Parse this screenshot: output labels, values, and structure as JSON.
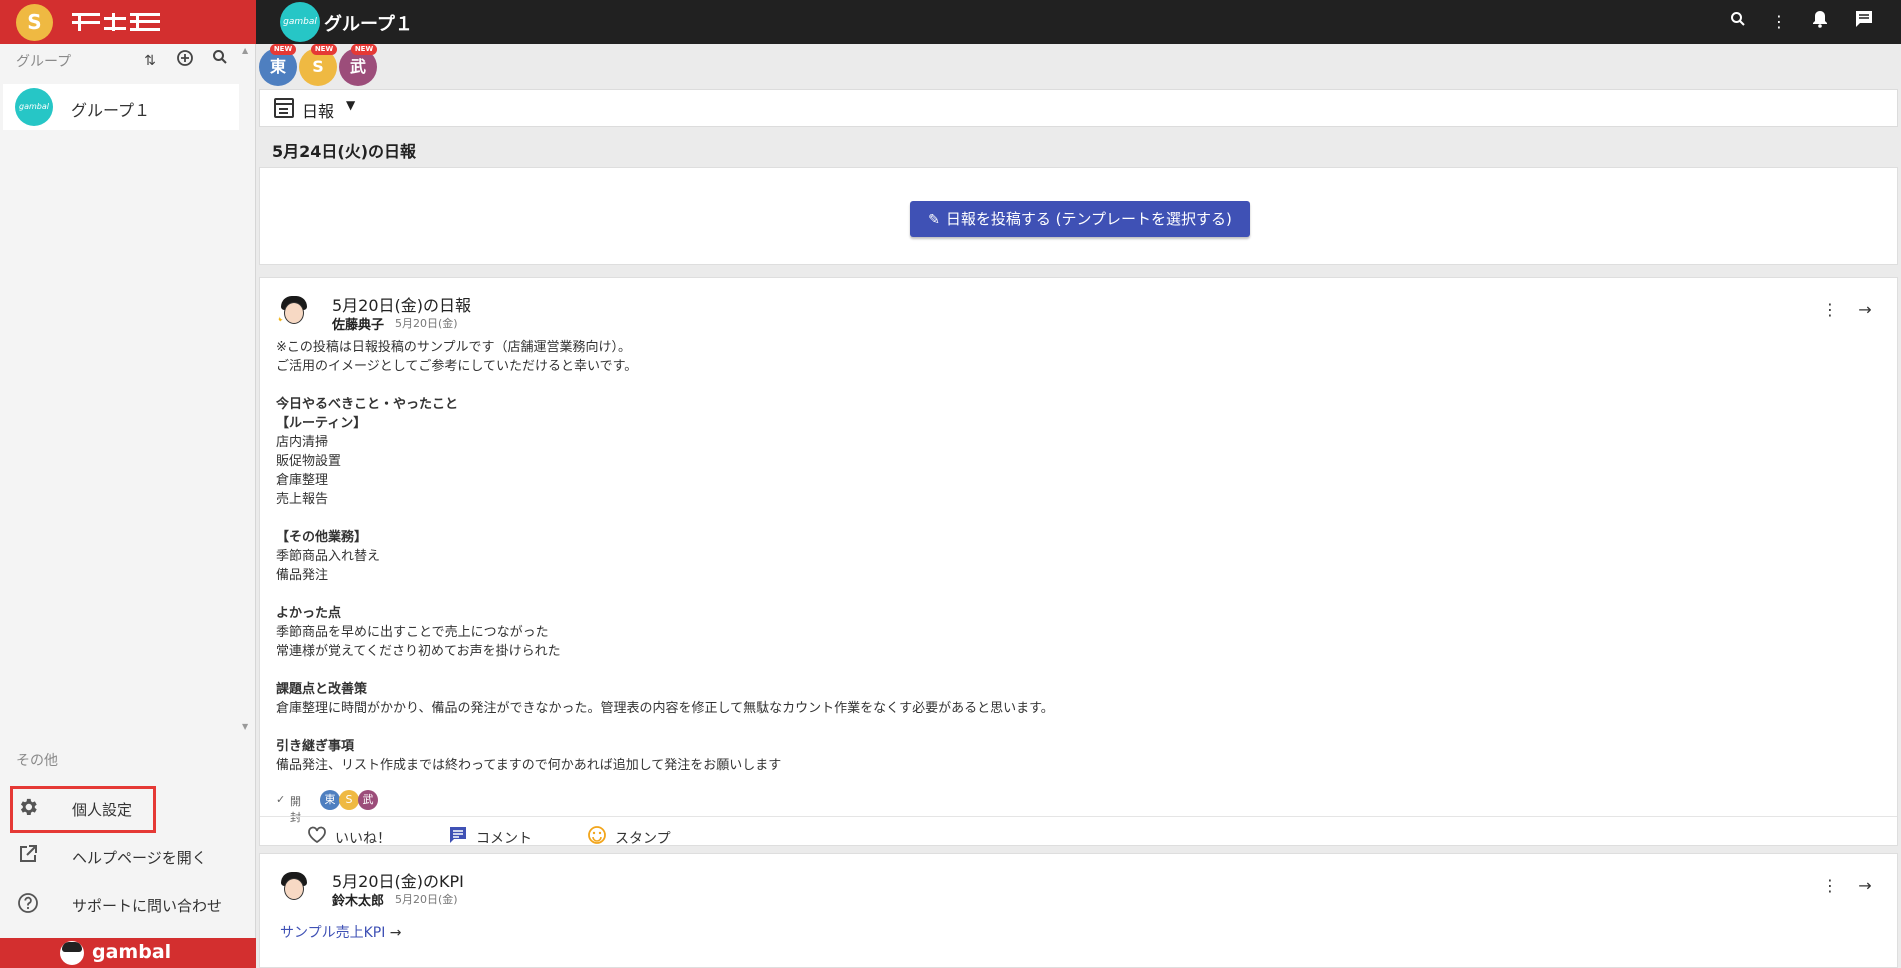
{
  "colors": {
    "brand_red": "#d32f2f",
    "topbar_dark": "#212121",
    "primary_indigo": "#3f51b5",
    "gambal_teal": "#26c6c6"
  },
  "sidebar": {
    "user_avatar_initial": "S",
    "groups_label": "グループ",
    "group_tools": [
      "sort-icon",
      "add-circle-icon",
      "search-icon"
    ],
    "groups": [
      {
        "avatar_text": "gambal",
        "name": "グループ１"
      }
    ],
    "other_label": "その他",
    "menu": [
      {
        "icon": "gear-icon",
        "label": "個人設定"
      },
      {
        "icon": "open-in-new-icon",
        "label": "ヘルプページを開く"
      },
      {
        "icon": "help-circle-icon",
        "label": "サポートに問い合わせ"
      }
    ],
    "footer_logo": "gambal"
  },
  "topbar": {
    "group_avatar_text": "gambal",
    "title": "グループ１",
    "icons": [
      "search-icon",
      "more-vert-icon",
      "bell-icon",
      "chat-icon"
    ]
  },
  "members": [
    {
      "initial": "東",
      "badge": "NEW",
      "color": "#4e7fc0"
    },
    {
      "initial": "S",
      "badge": "NEW",
      "color": "#efb942"
    },
    {
      "initial": "武",
      "badge": "NEW",
      "color": "#9c4d7a"
    }
  ],
  "filter": {
    "label": "日報"
  },
  "section_title": "5月24日(火)の日報",
  "post_button_label": "日報を投稿する (テンプレートを選択する)",
  "posts": [
    {
      "title": "5月20日(金)の日報",
      "author": "佐藤典子",
      "date": "5月20日(金)",
      "body": [
        {
          "text": "※この投稿は日報投稿のサンプルです（店舗運営業務向け）。",
          "bold": false
        },
        {
          "text": "ご活用のイメージとしてご参考にしていただけると幸いです。",
          "bold": false
        },
        {
          "text": "",
          "bold": false
        },
        {
          "text": "今日やるべきこと・やったこと",
          "bold": true
        },
        {
          "text": "【ルーティン】",
          "bold": true
        },
        {
          "text": "店内清掃",
          "bold": false
        },
        {
          "text": "販促物設置",
          "bold": false
        },
        {
          "text": "倉庫整理",
          "bold": false
        },
        {
          "text": "売上報告",
          "bold": false
        },
        {
          "text": "",
          "bold": false
        },
        {
          "text": "【その他業務】",
          "bold": true
        },
        {
          "text": "季節商品入れ替え",
          "bold": false
        },
        {
          "text": "備品発注",
          "bold": false
        },
        {
          "text": "",
          "bold": false
        },
        {
          "text": "よかった点",
          "bold": true
        },
        {
          "text": "季節商品を早めに出すことで売上につながった",
          "bold": false
        },
        {
          "text": "常連様が覚えてくださり初めてお声を掛けられた",
          "bold": false
        },
        {
          "text": "",
          "bold": false
        },
        {
          "text": "課題点と改善策",
          "bold": true
        },
        {
          "text": "倉庫整理に時間がかかり、備品の発注ができなかった。管理表の内容を修正して無駄なカウント作業をなくす必要があると思います。",
          "bold": false
        },
        {
          "text": "",
          "bold": false
        },
        {
          "text": "引き継ぎ事項",
          "bold": true
        },
        {
          "text": "備品発注、リスト作成までは終わってますので何かあれば追加して発注をお願いします",
          "bold": false
        }
      ],
      "read_label": "開封",
      "readers": [
        {
          "initial": "東",
          "color": "#4e7fc0"
        },
        {
          "initial": "S",
          "color": "#efb942"
        },
        {
          "initial": "武",
          "color": "#9c4d7a"
        }
      ],
      "actions": [
        {
          "icon": "heart-outline-icon",
          "label": "いいね！"
        },
        {
          "icon": "comment-icon",
          "label": "コメント"
        },
        {
          "icon": "smiley-icon",
          "label": "スタンプ"
        }
      ]
    },
    {
      "title": "5月20日(金)のKPI",
      "author": "鈴木太郎",
      "date": "5月20日(金)",
      "link_label": "サンプル売上KPI"
    }
  ]
}
